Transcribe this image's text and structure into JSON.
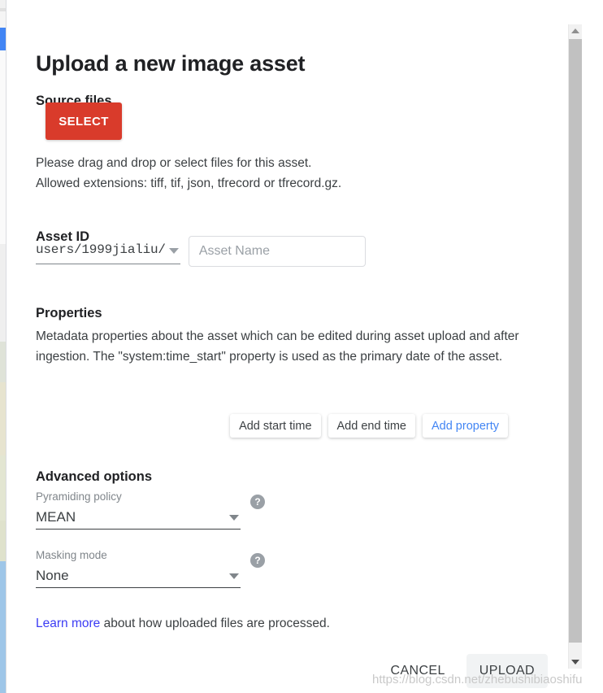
{
  "dialog": {
    "title": "Upload a new image asset"
  },
  "source": {
    "heading": "Source files",
    "select_label": "SELECT",
    "description": "Please drag and drop or select files for this asset.\nAllowed extensions: tiff, tif, json, tfrecord or tfrecord.gz."
  },
  "asset_id": {
    "heading": "Asset ID",
    "path_value": "users/1999jialiu/",
    "name_placeholder": "Asset Name",
    "name_value": ""
  },
  "properties": {
    "heading": "Properties",
    "description": "Metadata properties about the asset which can be edited during asset upload and after ingestion. The \"system:time_start\" property is used as the primary date of the asset.",
    "add_start_time_label": "Add start time",
    "add_end_time_label": "Add end time",
    "add_property_label": "Add property"
  },
  "advanced": {
    "heading": "Advanced options",
    "pyramiding": {
      "label": "Pyramiding policy",
      "value": "MEAN",
      "help_glyph": "?"
    },
    "masking": {
      "label": "Masking mode",
      "value": "None",
      "help_glyph": "?"
    }
  },
  "footer": {
    "learn_more_link": "Learn more",
    "learn_more_rest": " about how uploaded files are processed.",
    "cancel_label": "CANCEL",
    "upload_label": "UPLOAD"
  },
  "watermark": {
    "text": "https://blog.csdn.net/zhebushibiaoshifu"
  },
  "colors": {
    "select_red": "#d93b2b",
    "link_blue": "#4285f4",
    "learn_blue": "#3c3cf4",
    "text_dark": "#3c4043"
  }
}
